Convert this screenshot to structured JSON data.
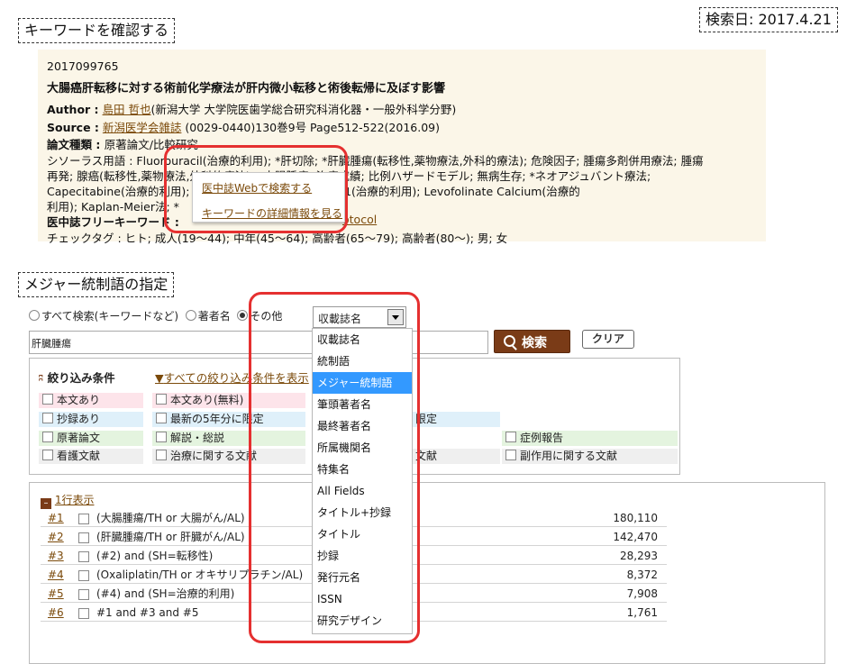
{
  "section1": {
    "title": "キーワードを確認する"
  },
  "search_date": "検索日: 2017.4.21",
  "record": {
    "id": "2017099765",
    "title": "大腸癌肝転移に対する術前化学療法が肝内微小転移と術後転帰に及ぼす影響",
    "author_label": "Author :",
    "author_name": "島田 哲也",
    "author_affil": "(新潟大学 大学院医歯学総合研究科消化器・一般外科学分野)",
    "source_label": "Source :",
    "source_journal": "新潟医学会雑誌",
    "source_detail": " (0029-0440)130巻9号 Page512-522(2016.09)",
    "type_label": "論文種類 : ",
    "type_value": "原著論文/比較研究",
    "thesaurus_line1": "シソーラス用語 : Fluorouracil(治療的利用); *肝切除; *肝臓腫瘍(転移性,薬物療法,外科的療法); 危険因子; 腫瘍多剤併用療法; 腫瘍",
    "thesaurus_line2": "再発; 腺癌(転移性,薬物療法,外科的療法); *大腸腫瘍; 治療成績; 比例ハザードモデル; 無病生存; *ネオアジュバント療法;",
    "thesaurus_line3": "Capecitabine(治療的利用); Oxaliplatin(治療的利用); TS-1(治療的利用); Levofolinate Calcium(治療的",
    "thesaurus_line4": "利用); Kaplan-Meier法; *",
    "free_kw": "医中誌フリーキーワード : ",
    "free_kw_end": "otocol",
    "check_tags": "チェックタグ : ヒト; 成人(19～44); 中年(45～64); 高齢者(65～79); 高齢者(80～); 男; 女"
  },
  "popup": {
    "item1": "医中誌Webで検索する",
    "item2": "キーワードの詳細情報を見る"
  },
  "section2": {
    "title": "メジャー統制語の指定"
  },
  "search_mode": {
    "opt1": "すべて検索(キーワードなど)",
    "opt2": "著者名",
    "opt3": "その他",
    "selected_field": "収載誌名"
  },
  "search_input": {
    "value": "肝臓腫瘍"
  },
  "buttons": {
    "search": "検索",
    "clear": "クリア"
  },
  "filters": {
    "header": "絞り込み条件",
    "show_all": "すべての絞り込み条件を表示",
    "items": [
      "本文あり",
      "本文あり(無料)",
      "抄録あり",
      "最新の5年分に限定",
      "限定",
      "原著論文",
      "解説・総説",
      "症例報告",
      "看護文献",
      "治療に関する文献",
      "文献",
      "副作用に関する文献"
    ]
  },
  "results": {
    "toggle": "1行表示",
    "rows": [
      {
        "num": "#1",
        "query": "(大腸腫瘍/TH or 大腸がん/AL)",
        "count": "180,110"
      },
      {
        "num": "#2",
        "query": "(肝臓腫瘍/TH or 肝臓がん/AL)",
        "count": "142,470"
      },
      {
        "num": "#3",
        "query": "(#2) and (SH=転移性)",
        "count": "28,293"
      },
      {
        "num": "#4",
        "query": "(Oxaliplatin/TH or オキサリプラチン/AL)",
        "count": "8,372"
      },
      {
        "num": "#5",
        "query": "(#4) and (SH=治療的利用)",
        "count": "7,908"
      },
      {
        "num": "#6",
        "query": "#1 and #3 and #5",
        "count": "1,761"
      }
    ]
  },
  "dropdown": {
    "items": [
      "収載誌名",
      "統制語",
      "メジャー統制語",
      "筆頭著者名",
      "最終著者名",
      "所属機関名",
      "特集名",
      "All Fields",
      "タイトル+抄録",
      "タイトル",
      "抄録",
      "発行元名",
      "ISSN",
      "研究デザイン"
    ],
    "selected": "メジャー統制語"
  },
  "colors": {
    "accent_red": "#e53030",
    "link_brown": "#7b4a0a",
    "search_button": "#7a3b17",
    "selected_blue": "#3399ff"
  }
}
